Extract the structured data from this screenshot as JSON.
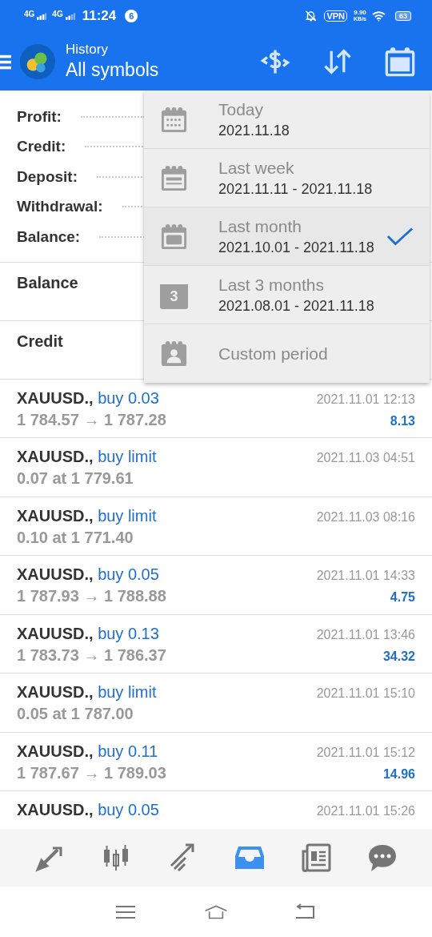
{
  "status_bar": {
    "network_1": "4G",
    "network_2": "4G",
    "time": "11:24",
    "notification_count": "6",
    "vpn": "VPN",
    "speed": "9.90",
    "speed_unit": "KB/s",
    "battery": "63"
  },
  "header": {
    "title": "History",
    "subtitle": "All symbols"
  },
  "summary": [
    {
      "label": "Profit:"
    },
    {
      "label": "Credit:"
    },
    {
      "label": "Deposit:"
    },
    {
      "label": "Withdrawal:"
    },
    {
      "label": "Balance:"
    }
  ],
  "sections": [
    {
      "label": "Balance"
    },
    {
      "label": "Credit"
    }
  ],
  "trades": [
    {
      "symbol": "XAUUSD.,",
      "action": "buy 0.03",
      "time": "2021.11.01 12:13",
      "prices": "1 784.57 → 1 787.28",
      "profit": "8.13"
    },
    {
      "symbol": "XAUUSD.,",
      "action": "buy limit",
      "time": "2021.11.03 04:51",
      "prices": "0.07 at 1 779.61"
    },
    {
      "symbol": "XAUUSD.,",
      "action": "buy limit",
      "time": "2021.11.03 08:16",
      "prices": "0.10 at 1 771.40"
    },
    {
      "symbol": "XAUUSD.,",
      "action": "buy 0.05",
      "time": "2021.11.01 14:33",
      "prices": "1 787.93 → 1 788.88",
      "profit": "4.75"
    },
    {
      "symbol": "XAUUSD.,",
      "action": "buy 0.13",
      "time": "2021.11.01 13:46",
      "prices": "1 783.73 → 1 786.37",
      "profit": "34.32"
    },
    {
      "symbol": "XAUUSD.,",
      "action": "buy limit",
      "time": "2021.11.01 15:10",
      "prices": "0.05 at 1 787.00"
    },
    {
      "symbol": "XAUUSD.,",
      "action": "buy 0.11",
      "time": "2021.11.01 15:12",
      "prices": "1 787.67 → 1 789.03",
      "profit": "14.96"
    },
    {
      "symbol": "XAUUSD.,",
      "action": "buy 0.05",
      "time": "2021.11.01 15:26"
    }
  ],
  "period_menu": [
    {
      "kind": "day",
      "label": "Today",
      "range": "2021.11.18",
      "selected": false
    },
    {
      "kind": "week",
      "label": "Last week",
      "range": "2021.11.11 - 2021.11.18",
      "selected": false
    },
    {
      "kind": "month",
      "label": "Last month",
      "range": "2021.10.01 - 2021.11.18",
      "selected": true
    },
    {
      "kind": "quarter",
      "label": "Last 3 months",
      "range": "2021.08.01 - 2021.11.18",
      "selected": false
    },
    {
      "kind": "custom",
      "label": "Custom period",
      "selected": false
    }
  ],
  "quarter_icon_digit": "3",
  "bottom_nav": [
    {
      "kind": "trade",
      "selected": false
    },
    {
      "kind": "quotes",
      "selected": false
    },
    {
      "kind": "chart",
      "selected": false
    },
    {
      "kind": "history",
      "selected": true
    },
    {
      "kind": "news",
      "selected": false
    },
    {
      "kind": "chat",
      "selected": false
    }
  ]
}
